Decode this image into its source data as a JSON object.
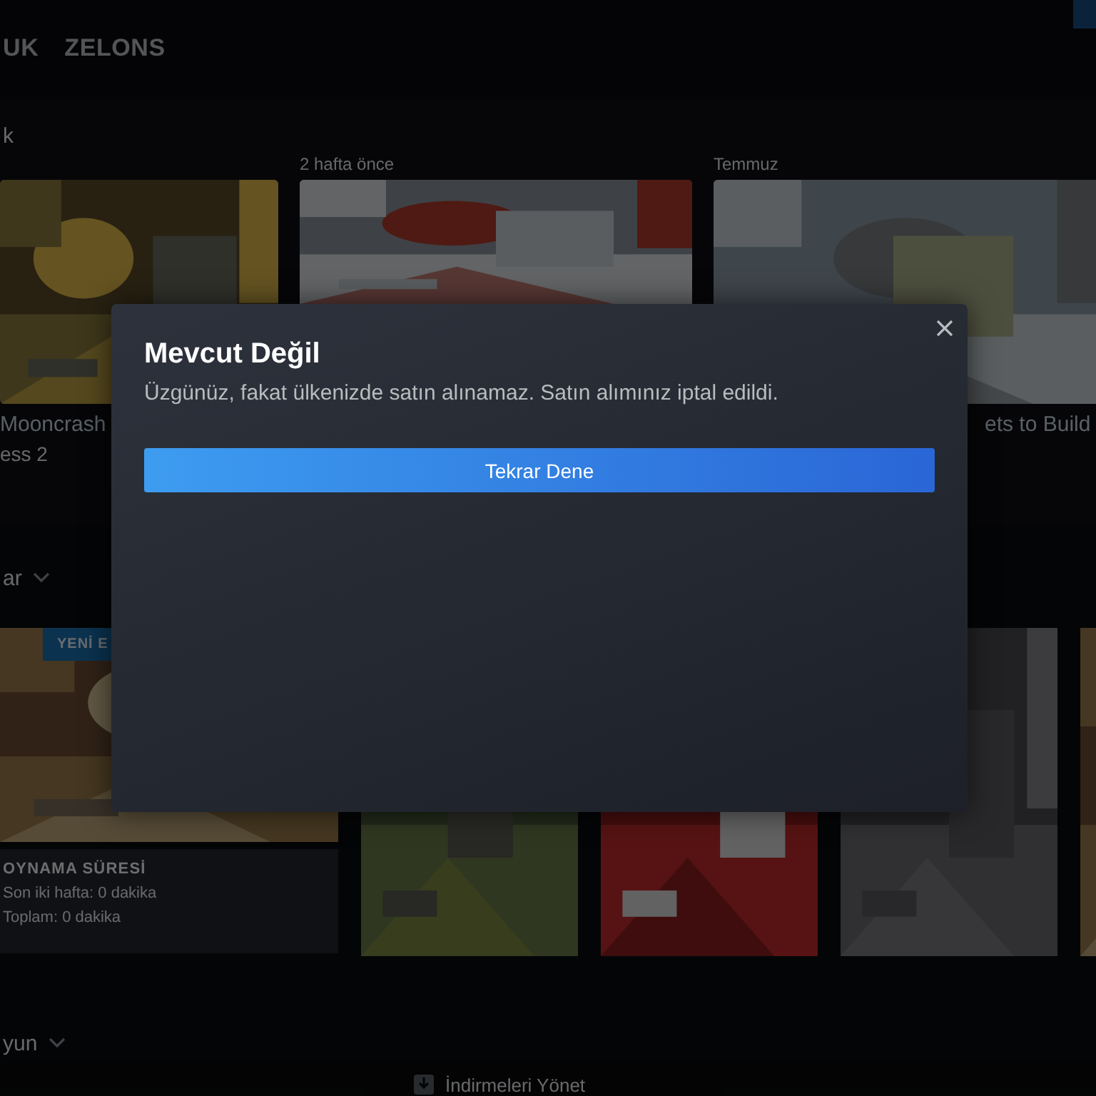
{
  "nav": {
    "items": [
      "UK",
      "ZELONS"
    ]
  },
  "news": {
    "heading": "k",
    "cards": [
      {
        "title": "Mooncrash",
        "subtitle": "ess 2"
      },
      {
        "date": "2 hafta önce"
      },
      {
        "date": "Temmuz",
        "title": "ets to Build"
      }
    ]
  },
  "library": {
    "heading": "ar",
    "featured": {
      "badge": "YENİ E",
      "playtime_label": "OYNAMA SÜRESİ",
      "lines": [
        "Son iki hafta: 0 dakika",
        "Toplam: 0 dakika"
      ]
    }
  },
  "section_3": {
    "heading": "yun"
  },
  "footer": {
    "downloads": "İndirmeleri Yönet"
  },
  "dialog": {
    "title": "Mevcut Değil",
    "message": "Üzgünüz, fakat ülkenizde satın alınamaz. Satın alımınız iptal edildi.",
    "button": "Tekrar Dene"
  }
}
